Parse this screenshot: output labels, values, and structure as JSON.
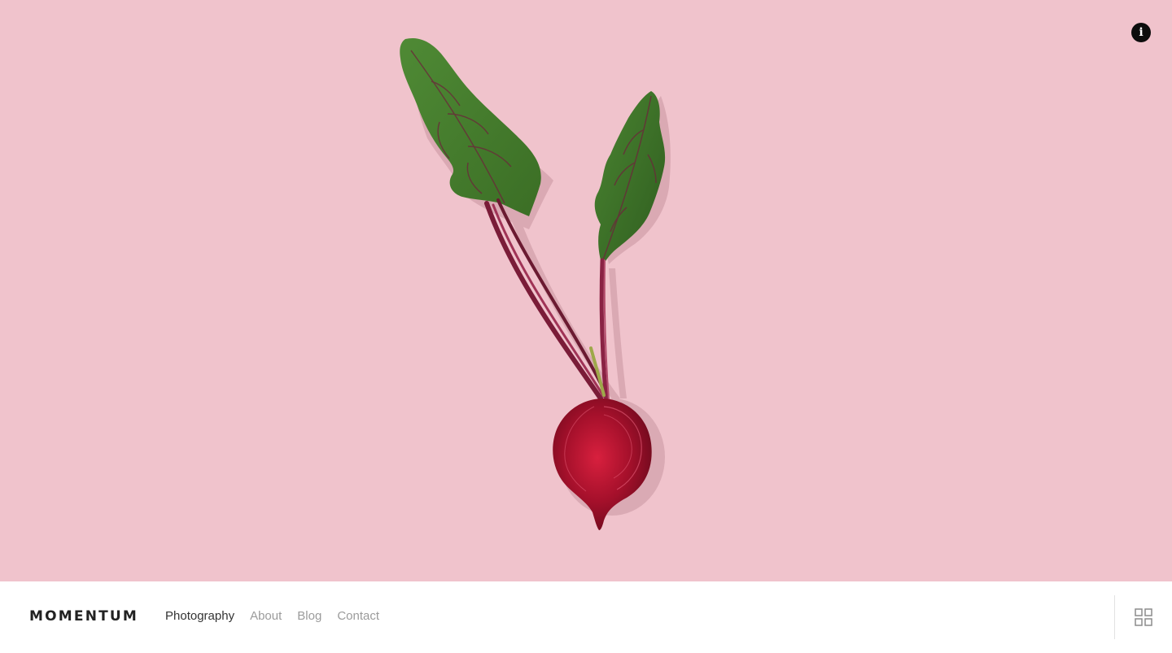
{
  "site": {
    "logo": "MOMENTUM"
  },
  "nav": {
    "items": [
      {
        "label": "Photography",
        "active": true
      },
      {
        "label": "About",
        "active": false
      },
      {
        "label": "Blog",
        "active": false
      },
      {
        "label": "Contact",
        "active": false
      }
    ]
  },
  "hero": {
    "background_color": "#f0c3cc",
    "subject": "beetroot-half-with-leaves",
    "info_icon_glyph": "i"
  },
  "icons": {
    "info": "info-icon",
    "gallery_grid": "grid-icon"
  },
  "colors": {
    "footer_bg": "#ffffff",
    "nav_active": "#333333",
    "nav_inactive": "#9b9b9b",
    "logo": "#222222"
  }
}
